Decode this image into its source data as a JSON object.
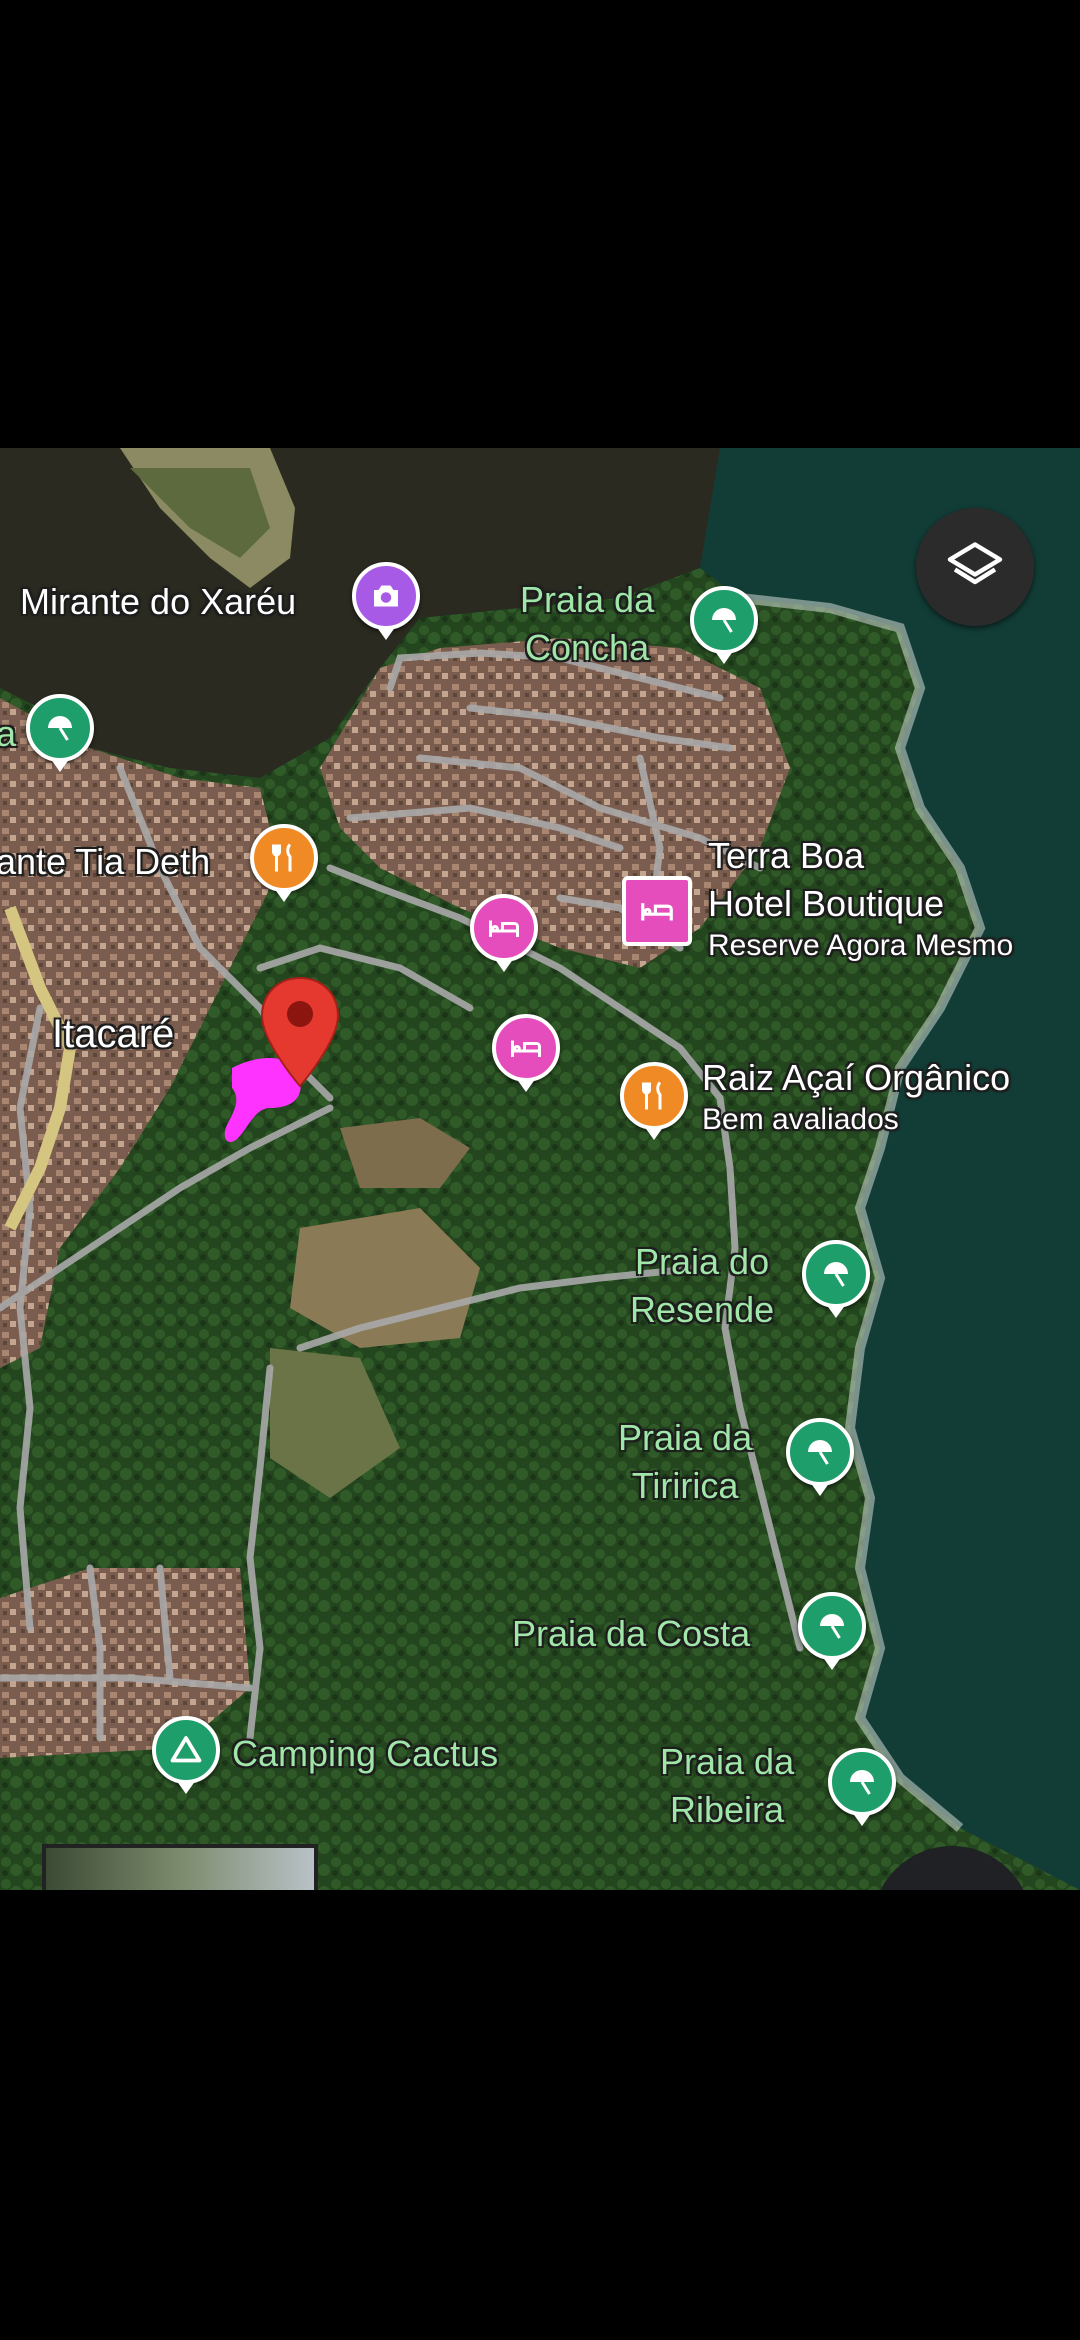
{
  "map": {
    "place_labels": {
      "mirante": "Mirante do Xaréu",
      "praia_concha_1": "Praia da",
      "praia_concha_2": "Concha",
      "tia_deth": "ante Tia Deth",
      "terra_boa_1": "Terra Boa",
      "terra_boa_2": "Hotel Boutique",
      "terra_boa_sub": "Reserve Agora Mesmo",
      "itacare": "Itacaré",
      "raiz_acai": "Raiz Açaí Orgânico",
      "raiz_acai_sub": "Bem avaliados",
      "resende_1": "Praia do",
      "resende_2": "Resende",
      "tiririca_1": "Praia da",
      "tiririca_2": "Tiririca",
      "costa": "Praia da Costa",
      "camping": "Camping Cactus",
      "ribeira_1": "Praia da",
      "ribeira_2": "Ribeira",
      "partial_a": "a"
    },
    "icons": {
      "beach": "umbrella-icon",
      "food": "fork-knife-icon",
      "hotel": "bed-icon",
      "photo": "camera-icon",
      "camp": "tent-icon",
      "layers": "layers-icon",
      "pin": "location-pin-icon"
    },
    "colors": {
      "beach": "#1e9e6a",
      "food": "#f08a24",
      "hotel": "#e64dbc",
      "photo": "#a65ae6",
      "pin": "#e5382e",
      "annotation": "#ff33ff"
    }
  }
}
